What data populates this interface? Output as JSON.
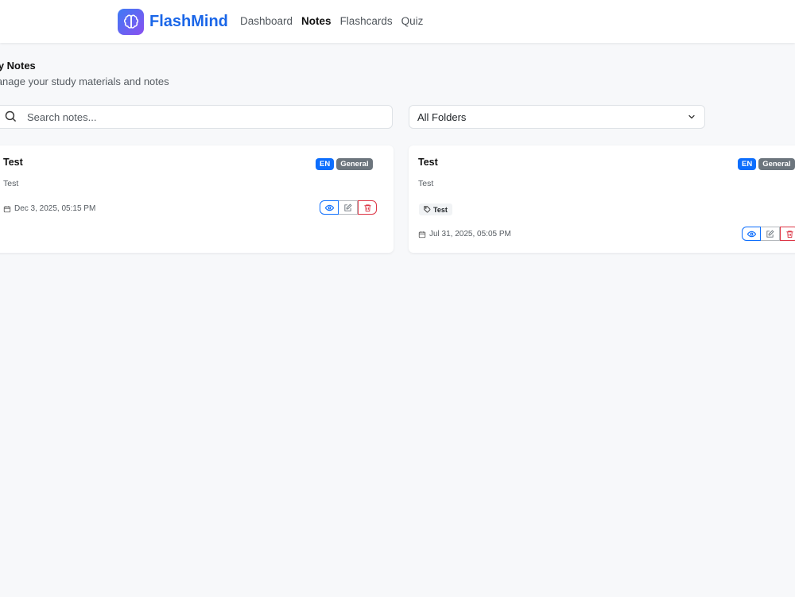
{
  "brand": {
    "name": "FlashMind",
    "icon": "brain-icon"
  },
  "nav": {
    "items": [
      {
        "label": "Dashboard",
        "active": false
      },
      {
        "label": "Notes",
        "active": true
      },
      {
        "label": "Flashcards",
        "active": false
      },
      {
        "label": "Quiz",
        "active": false
      }
    ]
  },
  "page": {
    "title": "My Notes",
    "subtitle": "Manage your study materials and notes"
  },
  "search": {
    "placeholder": "Search notes...",
    "value": ""
  },
  "folder_filter": {
    "selected": "All Folders"
  },
  "notes": [
    {
      "title": "Test",
      "content": "Test",
      "language": "EN",
      "folder": "General",
      "tags": [],
      "date": "Dec 3, 2025, 05:15 PM"
    },
    {
      "title": "Test",
      "content": "Test",
      "language": "EN",
      "folder": "General",
      "tags": [
        "Test"
      ],
      "date": "Jul 31, 2025, 05:05 PM"
    }
  ],
  "colors": {
    "primary": "#0d6efd",
    "brand_text": "#1a66e8",
    "danger": "#dc3545",
    "secondary": "#6c757d",
    "background": "#f7f8fa"
  }
}
